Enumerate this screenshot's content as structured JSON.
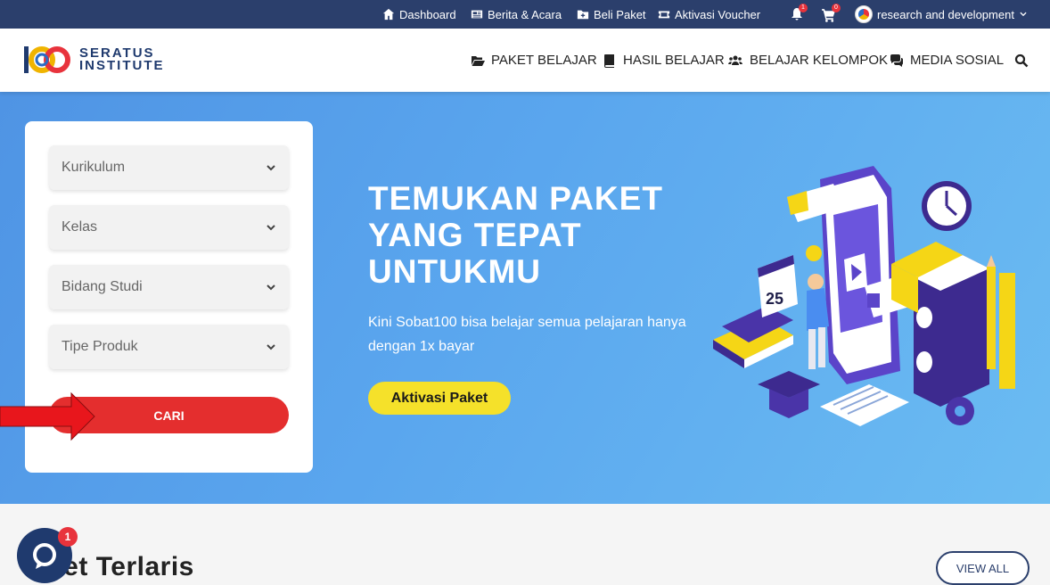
{
  "topbar": {
    "dashboard": "Dashboard",
    "news": "Berita & Acara",
    "buy_package": "Beli Paket",
    "voucher": "Aktivasi Voucher",
    "notification_count": "1",
    "cart_count": "0",
    "user_name": "research and development"
  },
  "logo": {
    "line1": "SERATUS",
    "line2": "INSTITUTE"
  },
  "nav": {
    "items": [
      "PAKET BELAJAR",
      "HASIL BELAJAR",
      "BELAJAR KELOMPOK",
      "MEDIA SOSIAL"
    ]
  },
  "filter": {
    "selects": [
      "Kurikulum",
      "Kelas",
      "Bidang Studi",
      "Tipe Produk"
    ],
    "search_button": "CARI"
  },
  "hero": {
    "title_lines": [
      "TEMUKAN PAKET",
      "YANG TEPAT",
      "UNTUKMU"
    ],
    "description": "Kini Sobat100 bisa belajar semua pelajaran hanya dengan 1x bayar",
    "cta": "Aktivasi Paket",
    "calendar_day": "25"
  },
  "section": {
    "title": "ket Terlaris",
    "view_all": "VIEW ALL"
  },
  "chat": {
    "badge": "1"
  },
  "colors": {
    "topbar": "#2b3f6c",
    "primary_red": "#e42e2e",
    "cta_yellow": "#f5e12a",
    "hero_blue": "#5aa6ee"
  }
}
